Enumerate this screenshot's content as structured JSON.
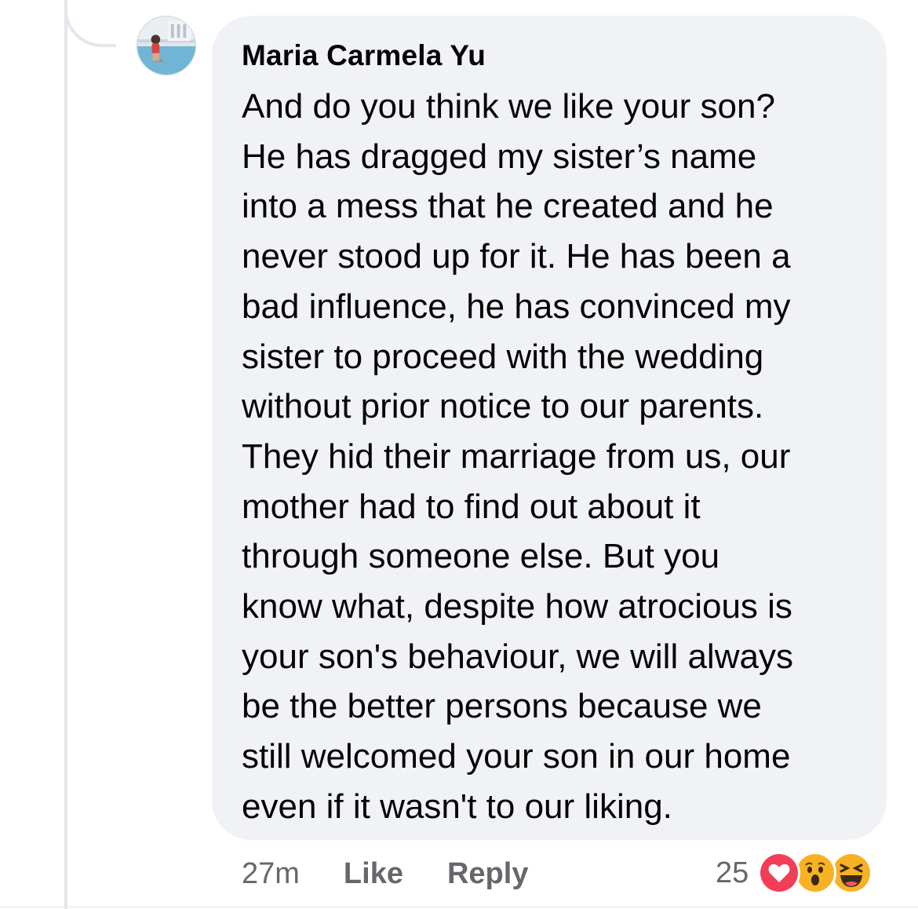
{
  "comment": {
    "author": "Maria Carmela Yu",
    "text": "And do you think we like your son?\nHe has dragged my sister’s name\ninto a mess that he created and he\nnever stood up for it. He has been a\nbad influence, he has convinced my\nsister to proceed with the wedding\nwithout prior notice to our parents.\nThey hid their marriage from us, our\nmother had to find out about it\nthrough someone else. But you\nknow what, despite how atrocious is\nyour son's behaviour, we will always\nbe the better persons because we\nstill welcomed your son in our home\neven if it wasn't to our liking."
  },
  "meta": {
    "time": "27m",
    "like_label": "Like",
    "reply_label": "Reply"
  },
  "reactions": {
    "count": "25",
    "icons": [
      "love-reaction-icon",
      "wow-reaction-icon",
      "haha-reaction-icon"
    ],
    "colors": {
      "love": "#f33e58",
      "wow": "#f7b125",
      "haha": "#f7b125"
    }
  },
  "colors": {
    "bubble": "#f0f2f5",
    "text": "#050505",
    "secondary": "#65676b",
    "thread_line": "#e4e6ea"
  }
}
